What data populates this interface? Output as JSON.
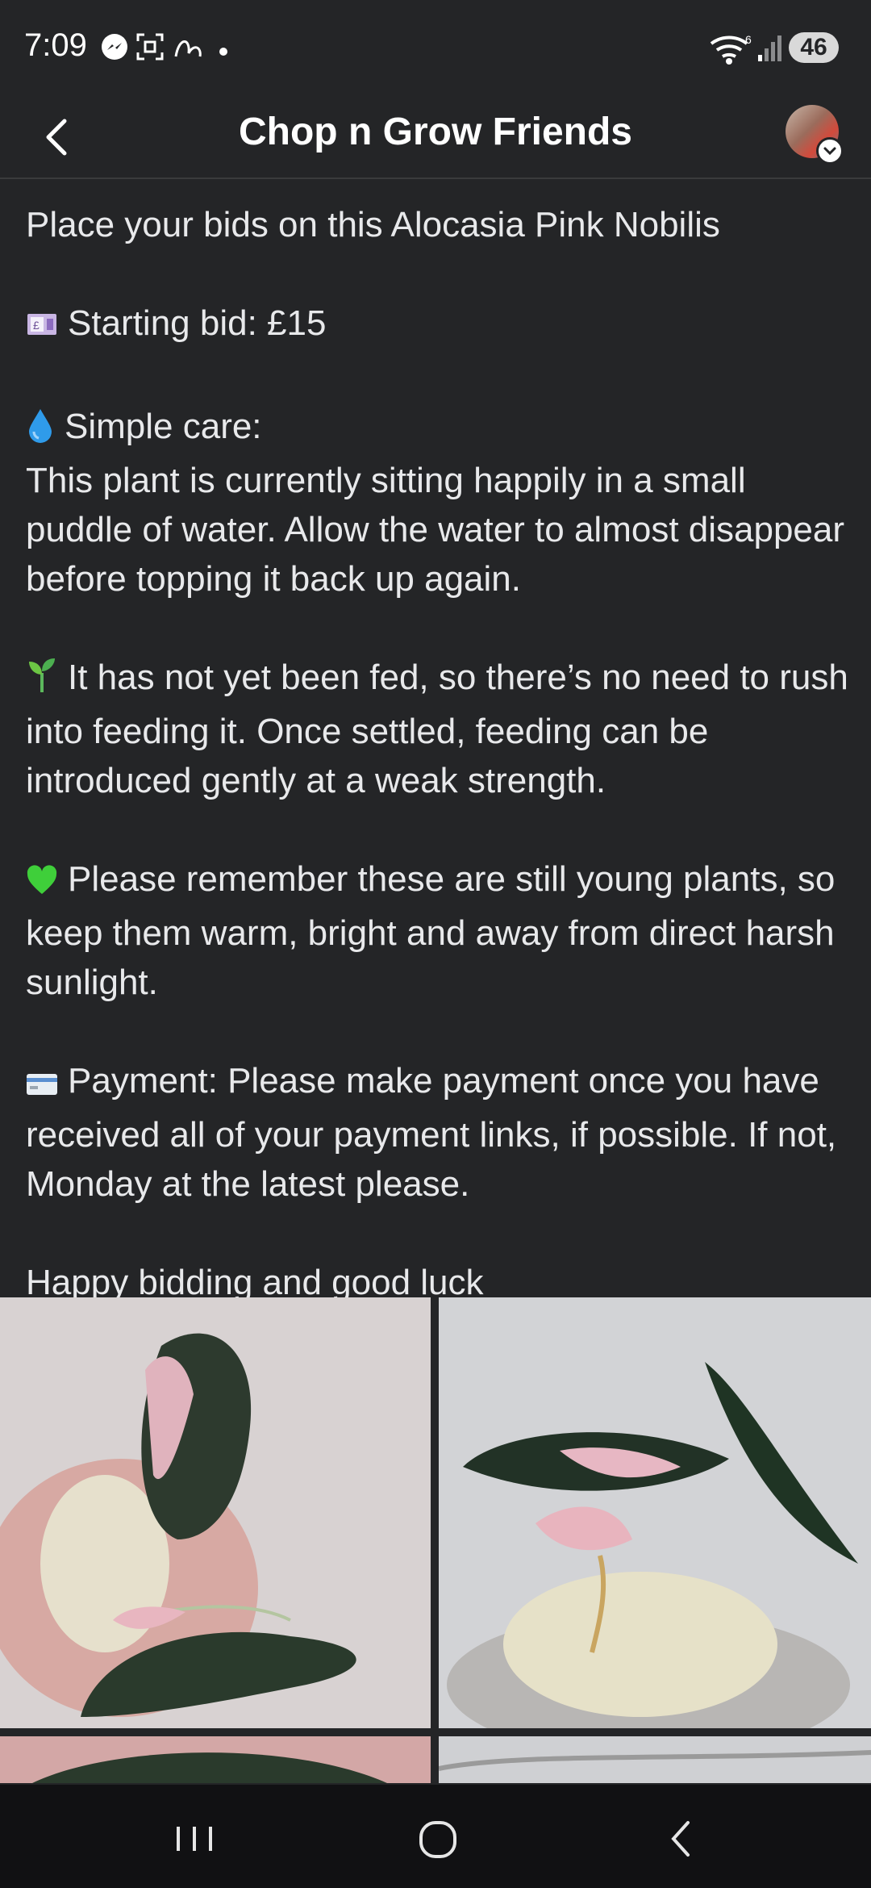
{
  "status_bar": {
    "time": "7:09",
    "battery": "46"
  },
  "header": {
    "title": "Chop n Grow Friends"
  },
  "post": {
    "line1": "Place your bids on this Alocasia Pink Nobilis",
    "bid": "Starting bid: £15",
    "care_heading": "Simple care:",
    "care_text": "This plant is currently sitting happily in a small puddle of water. Allow the water to almost disappear before topping it back up again.",
    "feeding": "It has not yet been fed, so there’s no need to rush into feeding it. Once settled, feeding can be introduced gently at a weak strength.",
    "remember": "Please remember these are still young plants, so keep them warm, bright and away from direct harsh sunlight.",
    "payment": "Payment: Please make payment once you have received all of your payment links, if possible. If not, Monday at the latest please.",
    "closing": "Happy bidding and good luck"
  },
  "icons": {
    "money": "money-icon",
    "droplet": "droplet-icon",
    "seedling": "seedling-icon",
    "heart": "green-heart-icon",
    "card": "credit-card-icon"
  },
  "colors": {
    "background": "#242527",
    "text": "#e4e6eb",
    "navbar": "#111113"
  }
}
